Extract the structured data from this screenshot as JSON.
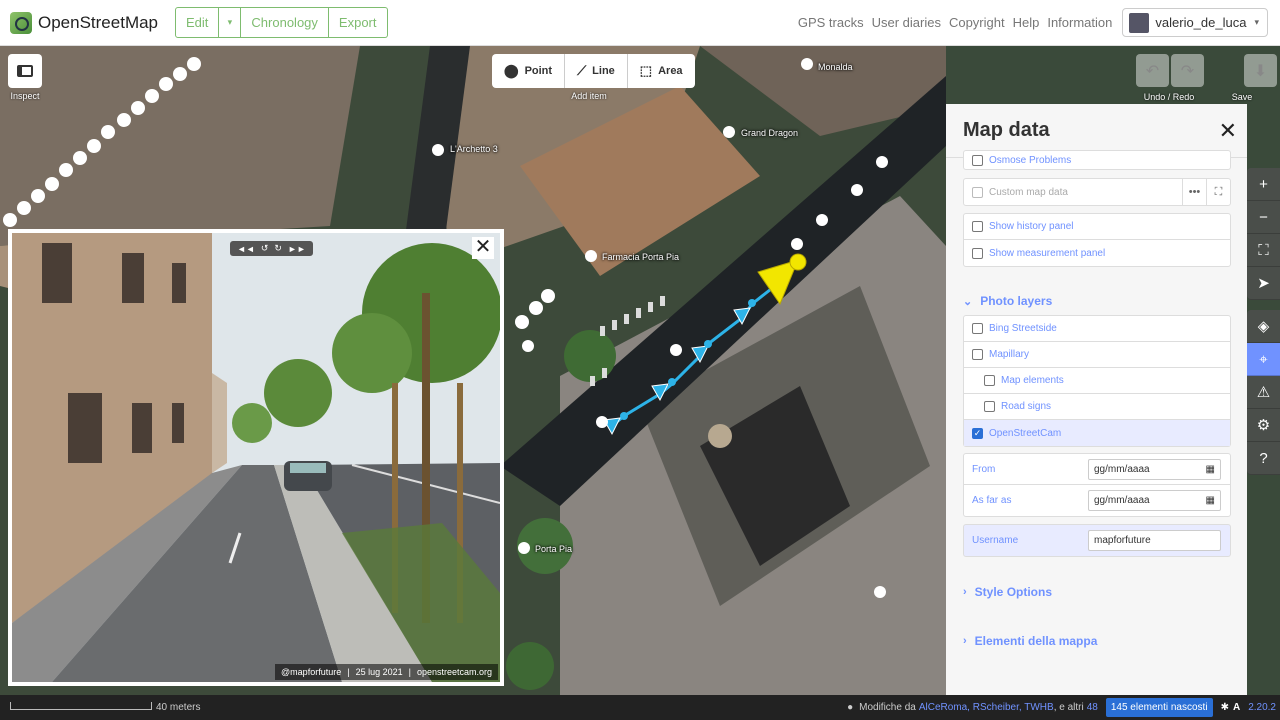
{
  "topnav": {
    "brand": "OpenStreetMap",
    "edit_label": "Edit",
    "caret": "▾",
    "chronology_label": "Chronology",
    "export_label": "Export",
    "links": [
      "GPS tracks",
      "User diaries",
      "Copyright",
      "Help",
      "Information"
    ],
    "username": "valerio_de_luca"
  },
  "toolbar": {
    "inspect_label": "Inspect",
    "add_item_label": "Add item",
    "point_label": "Point",
    "line_label": "Line",
    "area_label": "Area",
    "undo_redo_label": "Undo / Redo",
    "save_label": "Save"
  },
  "map_labels": {
    "monalda": "Monalda",
    "grand_dragon": "Grand Dragon",
    "archetto": "L'Archetto 3",
    "farmacia": "Farmacia Porta Pia",
    "porta_pia": "Porta Pia"
  },
  "photo": {
    "credit_user": "@mapforfuture",
    "credit_date": "25 lug 2021",
    "credit_site": "openstreetcam.org",
    "close": "✕",
    "nav": [
      "◄◄",
      "↺",
      "↻",
      "►►"
    ]
  },
  "panel": {
    "title": "Map data",
    "close": "✕",
    "data_layers": {
      "osmose": "Osmose Problems",
      "custom": "Custom map data",
      "history": "Show history panel",
      "measurement": "Show measurement panel"
    },
    "photo_layers_title": "Photo layers",
    "photo_layers": {
      "bing": "Bing Streetside",
      "mapillary": "Mapillary",
      "map_elements": "Map elements",
      "road_signs": "Road signs",
      "openstreetcam": "OpenStreetCam"
    },
    "from_label": "From",
    "to_label": "As far as",
    "date_placeholder": "gg/mm/aaaa",
    "username_label": "Username",
    "username_value": "mapforfuture",
    "style_options": "Style Options",
    "map_elements_section": "Elementi della mappa"
  },
  "footer": {
    "scale": "40 meters",
    "modified_by": "Modifiche da",
    "contributors": "AlCeRoma, RScheiber, TWHB",
    "and_others": ", e altri",
    "others_count": "48",
    "hidden": "145 elementi nascosti",
    "version": "2.20.2"
  },
  "colors": {
    "accent": "#7092ff",
    "brand_green": "#7ebc6f",
    "sequence": "#2db3e8",
    "selected_marker": "#f2e600"
  }
}
